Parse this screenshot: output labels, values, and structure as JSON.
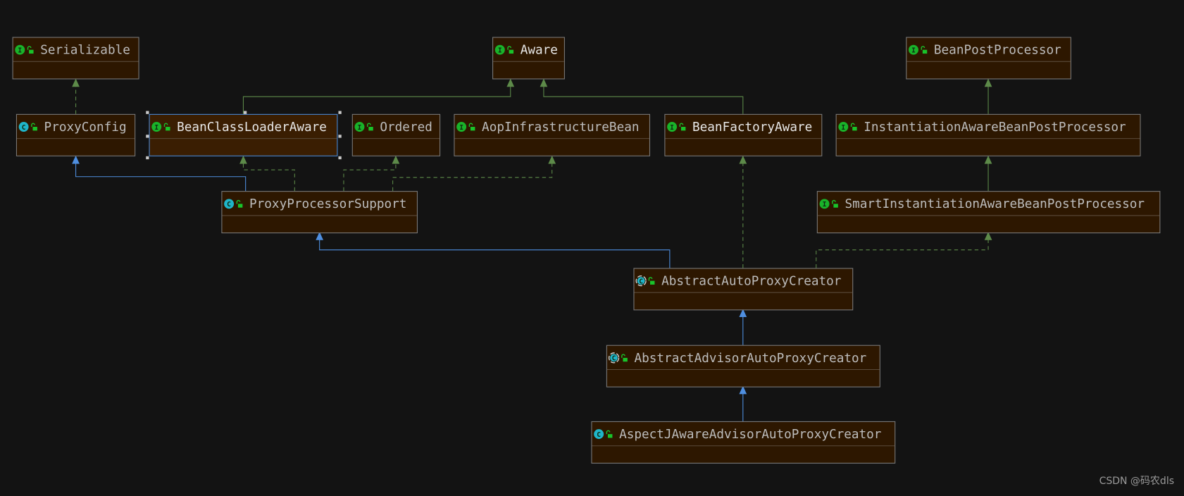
{
  "colors": {
    "background": "#131313",
    "box_fill": "#2d1700",
    "interface_icon": "#19b32a",
    "class_icon": "#1fb5c9",
    "lock_icon": "#19c42a",
    "realization_edge": "#5d8a49",
    "inheritance_edge": "#4f8fe0",
    "selection": "#4b8ad8"
  },
  "nodes": [
    {
      "id": "serializable",
      "label": "Serializable",
      "kind": "interface"
    },
    {
      "id": "aware",
      "label": "Aware",
      "kind": "interface",
      "bright": true
    },
    {
      "id": "bpp",
      "label": "BeanPostProcessor",
      "kind": "interface"
    },
    {
      "id": "proxyconfig",
      "label": "ProxyConfig",
      "kind": "class"
    },
    {
      "id": "bcla",
      "label": "BeanClassLoaderAware",
      "kind": "interface",
      "bright": true,
      "selected": true
    },
    {
      "id": "ordered",
      "label": "Ordered",
      "kind": "interface"
    },
    {
      "id": "aib",
      "label": "AopInfrastructureBean",
      "kind": "interface"
    },
    {
      "id": "bfa",
      "label": "BeanFactoryAware",
      "kind": "interface",
      "bright": true
    },
    {
      "id": "iabpp",
      "label": "InstantiationAwareBeanPostProcessor",
      "kind": "interface"
    },
    {
      "id": "pps",
      "label": "ProxyProcessorSupport",
      "kind": "class"
    },
    {
      "id": "siabpp",
      "label": "SmartInstantiationAwareBeanPostProcessor",
      "kind": "interface"
    },
    {
      "id": "aapc",
      "label": "AbstractAutoProxyCreator",
      "kind": "abstract"
    },
    {
      "id": "aaapc",
      "label": "AbstractAdvisorAutoProxyCreator",
      "kind": "abstract"
    },
    {
      "id": "ajaapc",
      "label": "AspectJAwareAdvisorAutoProxyCreator",
      "kind": "class"
    }
  ],
  "watermark": "CSDN @码农dls"
}
